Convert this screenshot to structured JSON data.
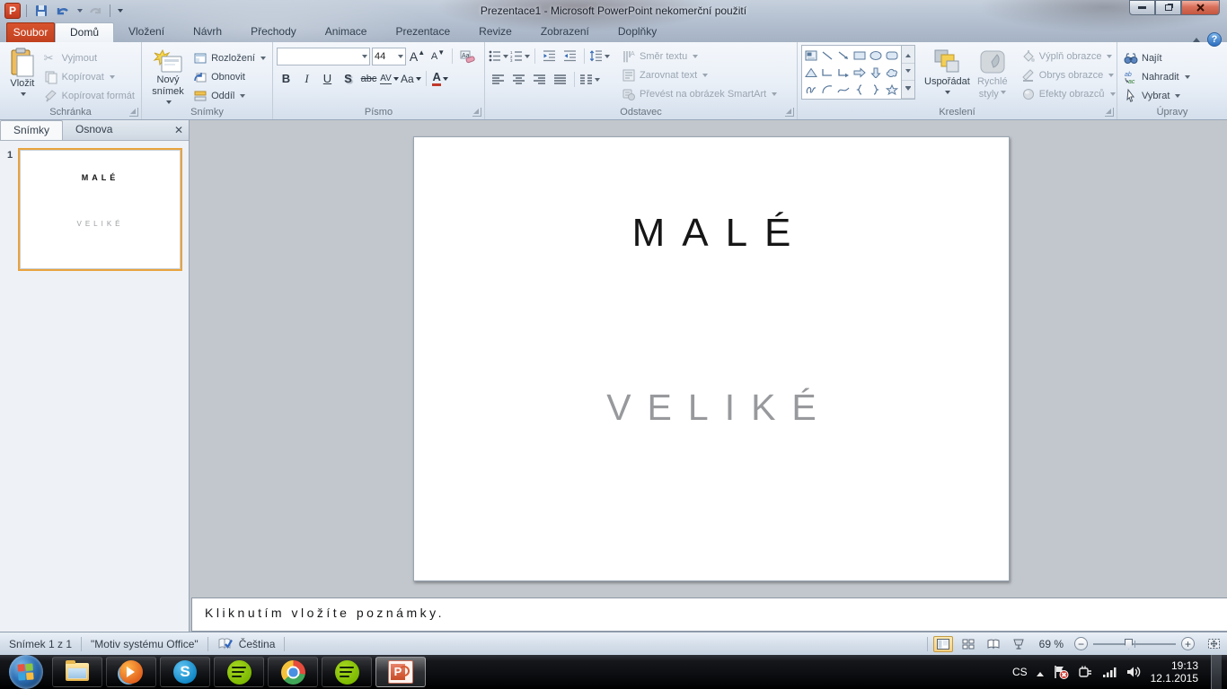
{
  "window": {
    "title": "Prezentace1  -  Microsoft PowerPoint nekomerční použití"
  },
  "icons": {
    "powerpoint_letter": "P",
    "skype_letter": "S",
    "cut_glyph": "✂",
    "check_glyph": "✓",
    "help_glyph": "?",
    "close_glyph": "✕"
  },
  "tabs": {
    "file": "Soubor",
    "items": [
      "Domů",
      "Vložení",
      "Návrh",
      "Přechody",
      "Animace",
      "Prezentace",
      "Revize",
      "Zobrazení",
      "Doplňky"
    ]
  },
  "ribbon": {
    "clipboard": {
      "label": "Schránka",
      "paste": "Vložit",
      "cut": "Vyjmout",
      "copy": "Kopírovat",
      "format_painter": "Kopírovat formát"
    },
    "slides": {
      "label": "Snímky",
      "new_slide_l1": "Nový",
      "new_slide_l2": "snímek",
      "layout": "Rozložení",
      "reset": "Obnovit",
      "section": "Oddíl"
    },
    "font": {
      "label": "Písmo",
      "size": "44",
      "bold": "B",
      "italic": "I",
      "underline": "U",
      "shadow": "S",
      "strike": "abc",
      "spacing": "AV",
      "case": "Aa",
      "color": "A",
      "grow": "A",
      "shrink": "A"
    },
    "paragraph": {
      "label": "Odstavec",
      "direction": "Směr textu",
      "align": "Zarovnat text",
      "smartart": "Převést na obrázek SmartArt"
    },
    "drawing": {
      "label": "Kreslení",
      "arrange": "Uspořádat",
      "styles_l1": "Rychlé",
      "styles_l2": "styly",
      "fill": "Výplň obrazce",
      "outline": "Obrys obrazce",
      "effects": "Efekty obrazců"
    },
    "editing": {
      "label": "Úpravy",
      "find": "Najít",
      "replace": "Nahradit",
      "select": "Vybrat"
    }
  },
  "slides_pane": {
    "tab_slides": "Snímky",
    "tab_outline": "Osnova",
    "number": "1"
  },
  "slide": {
    "title": "MALÉ",
    "subtitle": "VELIKÉ"
  },
  "notes": {
    "placeholder": "Kliknutím vložíte poznámky."
  },
  "status": {
    "slide": "Snímek 1 z 1",
    "theme": "\"Motiv systému Office\"",
    "language": "Čeština",
    "zoom": "69 %"
  },
  "tray": {
    "lang": "CS",
    "time": "19:13",
    "date": "12.1.2015"
  },
  "colors": {
    "file_tab": "#CD4A28",
    "selection_border": "#E8A33D",
    "slide_subtitle": "#97999C"
  }
}
